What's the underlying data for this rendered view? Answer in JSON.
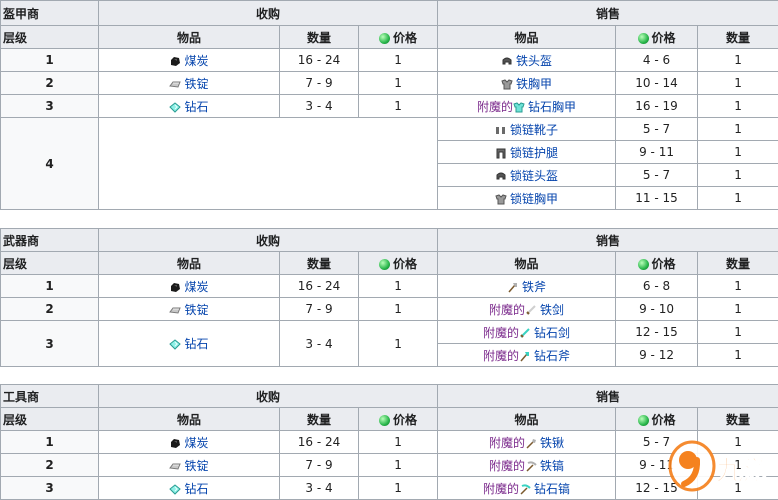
{
  "icons": {
    "coal": "coal-icon",
    "iron_ingot": "iron-ingot-icon",
    "emerald_item": "emerald-item-icon",
    "emerald_currency": "emerald-icon",
    "helmet": "helmet-icon",
    "chestplate": "chestplate-icon",
    "boots": "boots-icon",
    "leggings": "leggings-icon",
    "axe": "axe-icon",
    "sword": "sword-icon",
    "shovel": "shovel-icon",
    "pickaxe": "pickaxe-icon"
  },
  "colors": {
    "link": "#0645ad",
    "enchanted": "#7b2a8c",
    "header_bg": "#eaecf0",
    "border": "#a2a9b1"
  },
  "armorer": {
    "title": "盔甲商",
    "buy": "收购",
    "sell": "销售",
    "cols": {
      "level": "层级",
      "item": "物品",
      "qty": "数量",
      "price": "价格"
    },
    "rows": [
      {
        "level": "1",
        "buy_item": "煤炭",
        "buy_qty": "16 - 24",
        "buy_price": "1",
        "sell_item": "铁头盔",
        "sell_price": "4 - 6",
        "sell_qty": "1"
      },
      {
        "level": "2",
        "buy_item": "铁锭",
        "buy_qty": "7 - 9",
        "buy_price": "1",
        "sell_item": "铁胸甲",
        "sell_price": "10 - 14",
        "sell_qty": "1"
      },
      {
        "level": "3",
        "buy_item": "钻石",
        "buy_qty": "3 - 4",
        "buy_price": "1",
        "sell_prefix": "附魔的",
        "sell_item": "钻石胸甲",
        "sell_price": "16 - 19",
        "sell_qty": "1"
      }
    ],
    "level4": {
      "level": "4",
      "sells": [
        {
          "item": "锁链靴子",
          "price": "5 - 7",
          "qty": "1"
        },
        {
          "item": "锁链护腿",
          "price": "9 - 11",
          "qty": "1"
        },
        {
          "item": "锁链头盔",
          "price": "5 - 7",
          "qty": "1"
        },
        {
          "item": "锁链胸甲",
          "price": "11 - 15",
          "qty": "1"
        }
      ]
    }
  },
  "weaponsmith": {
    "title": "武器商",
    "buy": "收购",
    "sell": "销售",
    "cols": {
      "level": "层级",
      "item": "物品",
      "qty": "数量",
      "price": "价格"
    },
    "rows": [
      {
        "level": "1",
        "buy_item": "煤炭",
        "buy_qty": "16 - 24",
        "buy_price": "1",
        "sell_item": "铁斧",
        "sell_price": "6 - 8",
        "sell_qty": "1"
      },
      {
        "level": "2",
        "buy_item": "铁锭",
        "buy_qty": "7 - 9",
        "buy_price": "1",
        "sell_prefix": "附魔的",
        "sell_item": "铁剑",
        "sell_price": "9 - 10",
        "sell_qty": "1"
      }
    ],
    "level3": {
      "level": "3",
      "buy_item": "钻石",
      "buy_qty": "3 - 4",
      "buy_price": "1",
      "sells": [
        {
          "prefix": "附魔的",
          "item": "钻石剑",
          "price": "12 - 15",
          "qty": "1"
        },
        {
          "prefix": "附魔的",
          "item": "钻石斧",
          "price": "9 - 12",
          "qty": "1"
        }
      ]
    }
  },
  "toolsmith": {
    "title": "工具商",
    "buy": "收购",
    "sell": "销售",
    "cols": {
      "level": "层级",
      "item": "物品",
      "qty": "数量",
      "price": "价格"
    },
    "rows": [
      {
        "level": "1",
        "buy_item": "煤炭",
        "buy_qty": "16 - 24",
        "buy_price": "1",
        "sell_prefix": "附魔的",
        "sell_item": "铁锹",
        "sell_price": "5 - 7",
        "sell_qty": "1"
      },
      {
        "level": "2",
        "buy_item": "铁锭",
        "buy_qty": "7 - 9",
        "buy_price": "1",
        "sell_prefix": "附魔的",
        "sell_item": "铁镐",
        "sell_price": "9 - 11",
        "sell_qty": "1"
      },
      {
        "level": "3",
        "buy_item": "钻石",
        "buy_qty": "3 - 4",
        "buy_price": "1",
        "sell_prefix": "附魔的",
        "sell_item": "钻石镐",
        "sell_price": "12 - 15",
        "sell_qty": "1"
      }
    ]
  },
  "watermark": {
    "text": "九游",
    "brand_color": "#f5821f"
  }
}
